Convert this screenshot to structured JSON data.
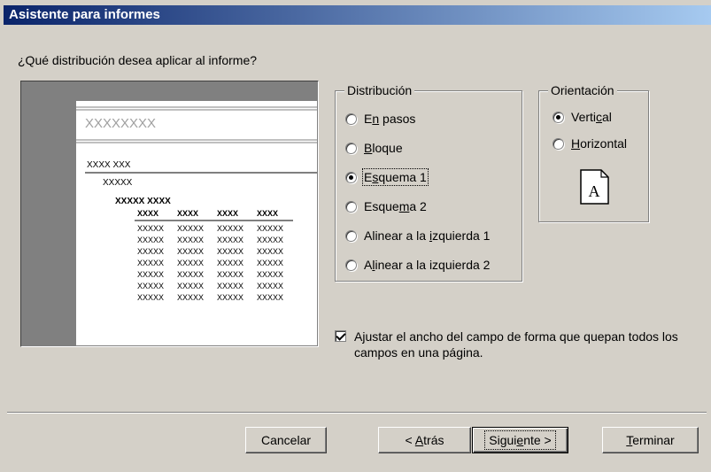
{
  "window": {
    "title": "Asistente para informes"
  },
  "question": "¿Qué distribución desea aplicar al informe?",
  "preview": {
    "title_placeholder": "XXXXXXXX",
    "group1": "XXXX XXX",
    "group2": "XXXXX",
    "group3": "XXXXX XXXX",
    "col_header": "XXXX",
    "cell": "XXXXX"
  },
  "distribucion": {
    "label": "Distribución",
    "options": [
      {
        "pre": "E",
        "u": "n",
        "post": " pasos",
        "selected": false
      },
      {
        "pre": "",
        "u": "B",
        "post": "loque",
        "selected": false
      },
      {
        "pre": "E",
        "u": "s",
        "post": "quema 1",
        "selected": true
      },
      {
        "pre": "Esque",
        "u": "m",
        "post": "a 2",
        "selected": false
      },
      {
        "pre": "Alinear a la ",
        "u": "i",
        "post": "zquierda 1",
        "selected": false
      },
      {
        "pre": "A",
        "u": "l",
        "post": "inear a la izquierda 2",
        "selected": false
      }
    ]
  },
  "orientacion": {
    "label": "Orientación",
    "options": [
      {
        "pre": "Verti",
        "u": "c",
        "post": "al",
        "selected": true
      },
      {
        "pre": "",
        "u": "H",
        "post": "orizontal",
        "selected": false
      }
    ],
    "icon_letter": "A"
  },
  "ajustar": {
    "checked": true,
    "pre": "A",
    "u": "j",
    "post": "ustar el ancho del campo de forma que quepan todos los campos en una página."
  },
  "buttons": {
    "cancelar": "Cancelar",
    "atras_pre": "< ",
    "atras_u": "A",
    "atras_post": "trás",
    "siguiente_pre": "Sigui",
    "siguiente_u": "e",
    "siguiente_post": "nte >",
    "terminar_u": "T",
    "terminar_post": "erminar"
  }
}
